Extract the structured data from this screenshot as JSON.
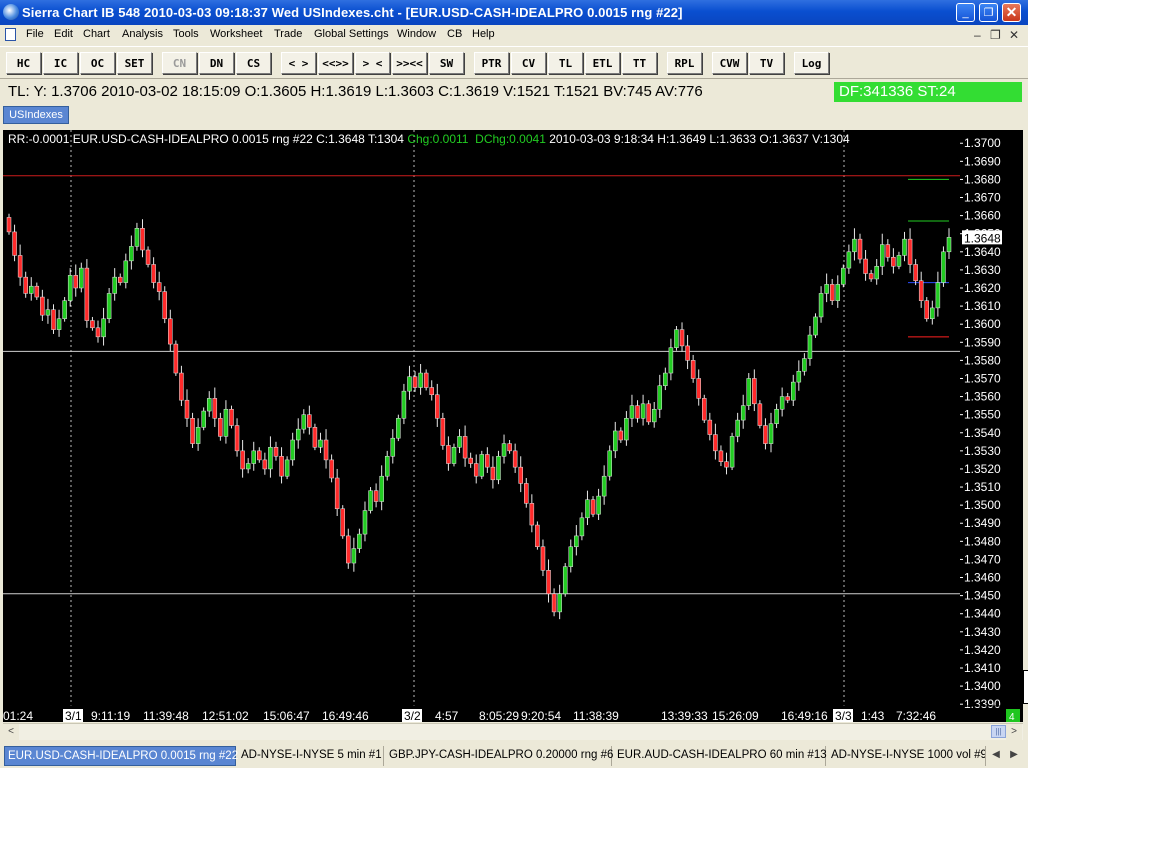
{
  "window": {
    "title": "Sierra Chart IB 548  2010-03-03  09:18:37  Wed   USIndexes.cht - [EUR.USD-CASH-IDEALPRO  0.0015 rng  #22]",
    "minimize": "_",
    "maximize": "❐",
    "close": "✕"
  },
  "menu": {
    "items": [
      "File",
      "Edit",
      "Chart",
      "Analysis",
      "Tools",
      "Worksheet",
      "Trade",
      "Global Settings",
      "Window",
      "CB",
      "Help"
    ],
    "mdi_minimize": "–",
    "mdi_restore": "❐",
    "mdi_close": "✕"
  },
  "toolbar": {
    "buttons": [
      "HC",
      "IC",
      "OC",
      "SET",
      "CN",
      "DN",
      "CS",
      "< >",
      "<<>>",
      "> <",
      ">><<",
      "SW",
      "PTR",
      "CV",
      "TL",
      "ETL",
      "TT",
      "RPL",
      "CVW",
      "TV",
      "Log"
    ]
  },
  "infobar": {
    "text": "TL: Y: 1.3706  2010-03-02  18:15:09  O:1.3605  H:1.3619  L:1.3603  C:1.3619  V:1521  T:1521  BV:745  AV:776",
    "df": "DF:341336  ST:24"
  },
  "sheet_tab": "USIndexes",
  "chart": {
    "header_left": "RR:-0.0001   EUR.USD-CASH-IDEALPRO  0.0015 rng  #22  C:1.3648  T:1304 ",
    "header_chg": "Chg:0.0011",
    "header_dchg": "DChg:0.0041",
    "header_right": " 2010-03-03  9:18:34   H:1.3649   L:1.3633   O:1.3637   V:1304",
    "last_price_label": "1.3648",
    "corner_box": "4",
    "colors": {
      "up": "#22cc22",
      "down": "#ff2a2a",
      "wick": "#ffffff",
      "hline_white": "#cfcfcf",
      "hline_red": "#cc1c1c",
      "background": "#000000"
    }
  },
  "chart_data": {
    "type": "candlestick",
    "y_tick_labels": [
      "1.3390",
      "1.3400",
      "1.3410",
      "1.3420",
      "1.3430",
      "1.3440",
      "1.3450",
      "1.3460",
      "1.3470",
      "1.3480",
      "1.3490",
      "1.3500",
      "1.3510",
      "1.3520",
      "1.3530",
      "1.3540",
      "1.3550",
      "1.3560",
      "1.3570",
      "1.3580",
      "1.3590",
      "1.3600",
      "1.3610",
      "1.3620",
      "1.3630",
      "1.3640",
      "1.3650",
      "1.3660",
      "1.3670",
      "1.3680",
      "1.3690",
      "1.3700"
    ],
    "ylim": [
      1.3389,
      1.3704
    ],
    "x_tick_labels": [
      "01:24",
      "3/1",
      "9:11:19",
      "11:39:48",
      "12:51:02",
      "15:06:47",
      "16:49:46",
      "3/2",
      "4:57",
      "8:05:29",
      "9:20:54",
      "11:38:39",
      "13:39:33",
      "15:26:09",
      "16:49:16",
      "3/3",
      "1:43",
      "7:32:46"
    ],
    "date_markers": [
      "3/1",
      "3/2",
      "3/3"
    ],
    "horizontal_lines": [
      {
        "price": 1.3682,
        "color": "red"
      },
      {
        "price": 1.3585,
        "color": "white"
      },
      {
        "price": 1.3451,
        "color": "white"
      }
    ],
    "short_lines": [
      {
        "price": 1.368,
        "color": "green"
      },
      {
        "price": 1.3657,
        "color": "green"
      },
      {
        "price": 1.3623,
        "color": "blue"
      },
      {
        "price": 1.3593,
        "color": "red"
      }
    ],
    "closes": [
      1.3651,
      1.3638,
      1.3626,
      1.3617,
      1.3621,
      1.3615,
      1.3605,
      1.3608,
      1.3597,
      1.3603,
      1.3613,
      1.3627,
      1.362,
      1.3631,
      1.3602,
      1.3598,
      1.3593,
      1.3603,
      1.3617,
      1.3626,
      1.3623,
      1.3635,
      1.3643,
      1.3653,
      1.3641,
      1.3633,
      1.3623,
      1.3618,
      1.3603,
      1.3589,
      1.3573,
      1.3558,
      1.3548,
      1.3534,
      1.3543,
      1.3552,
      1.3559,
      1.3548,
      1.3538,
      1.3553,
      1.3544,
      1.353,
      1.352,
      1.3523,
      1.353,
      1.3525,
      1.352,
      1.3532,
      1.3527,
      1.3516,
      1.3525,
      1.3536,
      1.3542,
      1.355,
      1.3543,
      1.3532,
      1.3536,
      1.3525,
      1.3515,
      1.3498,
      1.3483,
      1.3468,
      1.3476,
      1.3484,
      1.3497,
      1.3508,
      1.3502,
      1.3516,
      1.3527,
      1.3537,
      1.3548,
      1.3563,
      1.3571,
      1.3565,
      1.3573,
      1.3565,
      1.3561,
      1.3548,
      1.3533,
      1.3523,
      1.3532,
      1.3538,
      1.3526,
      1.3523,
      1.3516,
      1.3528,
      1.3521,
      1.3514,
      1.3527,
      1.3534,
      1.353,
      1.3521,
      1.3512,
      1.3501,
      1.3489,
      1.3477,
      1.3464,
      1.3451,
      1.3441,
      1.3451,
      1.3466,
      1.3477,
      1.3483,
      1.3493,
      1.3503,
      1.3495,
      1.3505,
      1.3516,
      1.353,
      1.3541,
      1.3536,
      1.3548,
      1.3555,
      1.3548,
      1.3556,
      1.3546,
      1.3553,
      1.3566,
      1.3573,
      1.3587,
      1.3597,
      1.3588,
      1.358,
      1.357,
      1.3559,
      1.3547,
      1.3539,
      1.353,
      1.3524,
      1.3521,
      1.3538,
      1.3547,
      1.3555,
      1.357,
      1.3556,
      1.3544,
      1.3534,
      1.3545,
      1.3553,
      1.356,
      1.3558,
      1.3568,
      1.3574,
      1.3581,
      1.3594,
      1.3604,
      1.3617,
      1.3622,
      1.3613,
      1.3622,
      1.3631,
      1.364,
      1.3647,
      1.3636,
      1.3628,
      1.3625,
      1.3632,
      1.3644,
      1.3637,
      1.3632,
      1.3638,
      1.3647,
      1.3633,
      1.3624,
      1.3613,
      1.3603,
      1.3609,
      1.3623,
      1.364,
      1.3648
    ]
  },
  "chart_tabs": [
    "EUR.USD-CASH-IDEALPRO  0.0015 rng  #22",
    "AD-NYSE-I-NYSE  5 min   #1",
    "GBP.JPY-CASH-IDEALPRO  0.20000 rng  #6",
    "EUR.AUD-CASH-IDEALPRO  60 min   #13",
    "AD-NYSE-I-NYSE  1000 vol  #9"
  ],
  "scroll": {
    "left": "<",
    "right": ">",
    "thumb": "|||",
    "tab_prev": "◀",
    "tab_next": "▶"
  }
}
